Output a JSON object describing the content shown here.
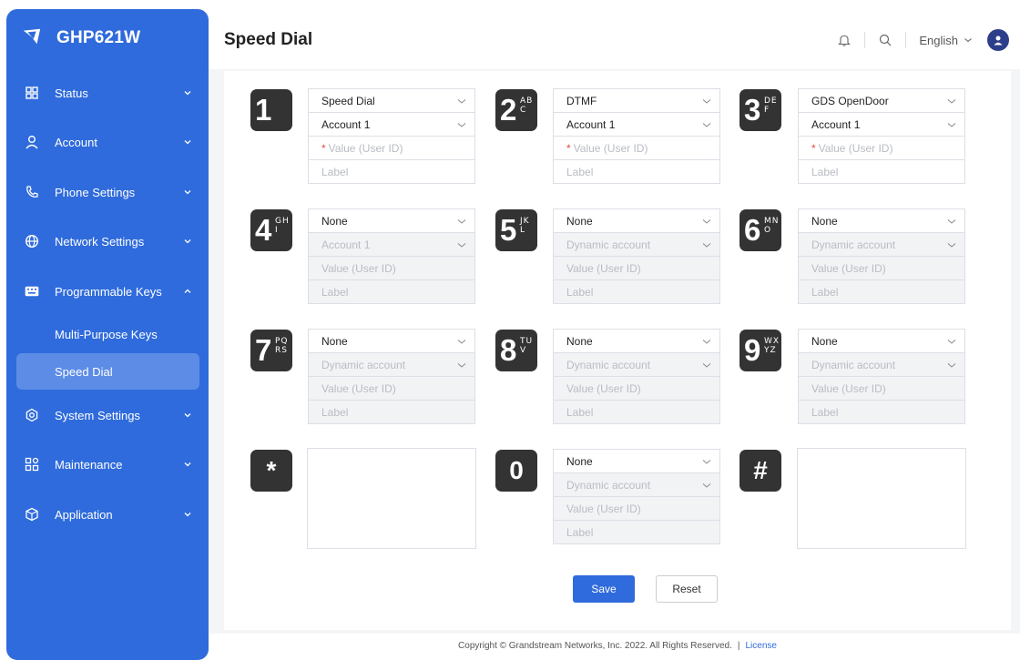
{
  "app": {
    "name": "GHP621W"
  },
  "sidebar": {
    "items": [
      {
        "label": "Status"
      },
      {
        "label": "Account"
      },
      {
        "label": "Phone Settings"
      },
      {
        "label": "Network Settings"
      },
      {
        "label": "Programmable Keys"
      },
      {
        "label": "System Settings"
      },
      {
        "label": "Maintenance"
      },
      {
        "label": "Application"
      }
    ],
    "subitems": [
      {
        "label": "Multi-Purpose Keys"
      },
      {
        "label": "Speed Dial"
      }
    ],
    "accent": "#2f6bdc"
  },
  "header": {
    "title": "Speed Dial",
    "language": "English"
  },
  "keys": [
    {
      "digit": "1",
      "letters": "",
      "mode": "Speed Dial",
      "account": "Account 1",
      "value_placeholder": "Value (User ID)",
      "label_placeholder": "Label"
    },
    {
      "digit": "2",
      "letters": "ABC",
      "mode": "DTMF",
      "account": "Account 1",
      "value_placeholder": "Value (User ID)",
      "label_placeholder": "Label"
    },
    {
      "digit": "3",
      "letters": "DEF",
      "mode": "GDS OpenDoor",
      "account": "Account 1",
      "value_placeholder": "Value (User ID)",
      "label_placeholder": "Label"
    },
    {
      "digit": "4",
      "letters": "GHI",
      "mode": "None",
      "account": "Account 1",
      "value_placeholder": "Value (User ID)",
      "label_placeholder": "Label"
    },
    {
      "digit": "5",
      "letters": "JKL",
      "mode": "None",
      "account": "Dynamic account",
      "value_placeholder": "Value (User ID)",
      "label_placeholder": "Label"
    },
    {
      "digit": "6",
      "letters": "MNO",
      "mode": "None",
      "account": "Dynamic account",
      "value_placeholder": "Value (User ID)",
      "label_placeholder": "Label"
    },
    {
      "digit": "7",
      "letters": "PQRS",
      "mode": "None",
      "account": "Dynamic account",
      "value_placeholder": "Value (User ID)",
      "label_placeholder": "Label"
    },
    {
      "digit": "8",
      "letters": "TUV",
      "mode": "None",
      "account": "Dynamic account",
      "value_placeholder": "Value (User ID)",
      "label_placeholder": "Label"
    },
    {
      "digit": "9",
      "letters": "WXYZ",
      "mode": "None",
      "account": "Dynamic account",
      "value_placeholder": "Value (User ID)",
      "label_placeholder": "Label"
    },
    {
      "digit": "*",
      "letters": ""
    },
    {
      "digit": "0",
      "letters": "",
      "mode": "None",
      "account": "Dynamic account",
      "value_placeholder": "Value (User ID)",
      "label_placeholder": "Label"
    },
    {
      "digit": "#",
      "letters": ""
    }
  ],
  "actions": {
    "save": "Save",
    "reset": "Reset"
  },
  "footer": {
    "copyright": "Copyright © Grandstream Networks, Inc. 2022. All Rights Reserved.",
    "separator": "|",
    "license": "License"
  }
}
